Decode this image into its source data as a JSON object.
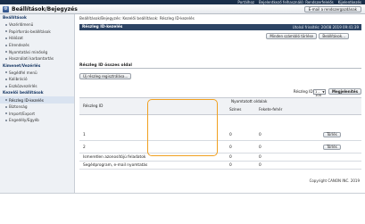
{
  "top_links": [
    "Portálhoz",
    "Bejelentkező felhasználó: Rendszerfelelős",
    "Kijelentkezés"
  ],
  "app": {
    "title": "Beállítások/Bejegyzés",
    "icon": "settings-app-icon",
    "mail_button": "E-mail a rendszergazdának"
  },
  "sidebar": {
    "section1": {
      "title": "Beállítások",
      "items": [
        "Vezérlőmenü",
        "Papírforrás-beállítások",
        "Hálózat",
        "Elrendezés",
        "Nyomtatási minőség",
        "Használati karbantartás"
      ]
    },
    "section2": {
      "title": "Kímenet/Vezérlés",
      "items": [
        "Segédfel menü",
        "Kalibráció",
        "Eszközvezérlés"
      ]
    },
    "section3": {
      "title": "Kezelői beállítások",
      "items": [
        "Részleg ID-kezelés",
        "Biztonság",
        "Import/Export",
        "Engedély/Egyéb"
      ]
    },
    "active_item": "Részleg ID-kezelés"
  },
  "breadcrumb": "Beállítások/Bejegyzés: Kezelői beállítások: Részleg ID-kezelés",
  "panel": {
    "title": "Részleg ID-kezelés",
    "updated": "Utolsó frissítés: 20/08 2019 09:41:39"
  },
  "toolbar": {
    "clear_all": "Minden számláló törlése",
    "settings": "Beállítások..."
  },
  "section": {
    "title": "Részleg ID összes oldal",
    "new_button": "Új részleg regisztrálása..."
  },
  "pagination": {
    "label": "Részleg ID:",
    "selected": "1 - 100",
    "show_button": "Megjelenítés"
  },
  "table": {
    "id_header": "Részleg ID",
    "group_header": "Nyomtatott oldalak",
    "col1": "Színes",
    "col2": "Fekete-fehér",
    "rows": [
      {
        "id": "1",
        "color": "0",
        "bw": "0",
        "action": "Törlés"
      },
      {
        "id": "2",
        "color": "0",
        "bw": "0",
        "action": "Törlés"
      },
      {
        "id": "Ismeretlen azonosítójú feladatok",
        "color": "0",
        "bw": "0",
        "action": ""
      },
      {
        "id": "Segédprogram, e-mail nyomtatás",
        "color": "0",
        "bw": "0",
        "action": ""
      }
    ]
  },
  "copyright": "Copyright CANON INC. 2019"
}
